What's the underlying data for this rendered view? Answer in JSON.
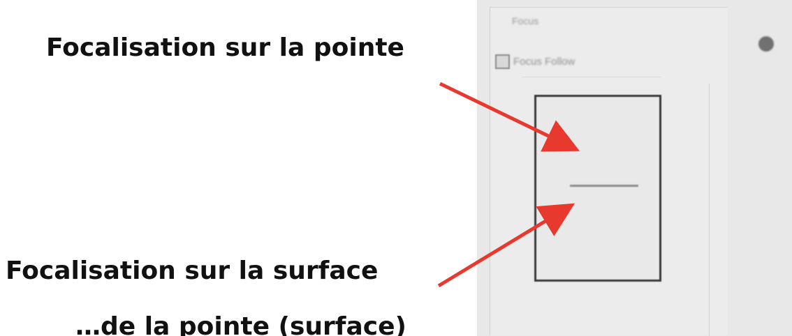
{
  "captions": {
    "tip": "Focalisation sur la pointe",
    "surface": "Focalisation sur la surface",
    "partial": "…de la pointe (surface)"
  },
  "panel": {
    "title": "Focus",
    "checkbox_label": "Focus Follow",
    "checkbox_checked": true
  },
  "colors": {
    "arrow": "#e8392e",
    "panel_bg": "#e8e8e8",
    "box_border": "#3c3c3c"
  }
}
